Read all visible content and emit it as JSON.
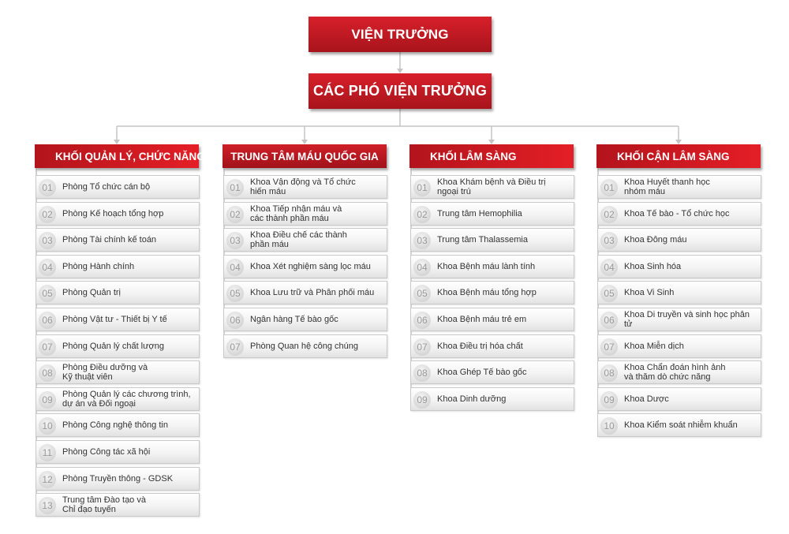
{
  "director": "VIỆN TRƯỞNG",
  "deputy": "CÁC PHÓ VIỆN TRƯỞNG",
  "columns": [
    {
      "title": "KHỐI QUẢN LÝ, CHỨC NĂNG",
      "items": [
        {
          "num": "01",
          "label": "Phòng Tổ chức cán bộ"
        },
        {
          "num": "02",
          "label": "Phòng Kế hoạch tổng hợp"
        },
        {
          "num": "03",
          "label": "Phòng Tài chính kế toán"
        },
        {
          "num": "04",
          "label": "Phòng Hành chính"
        },
        {
          "num": "05",
          "label": "Phòng Quản trị"
        },
        {
          "num": "06",
          "label": "Phòng Vật tư - Thiết bị Y tế"
        },
        {
          "num": "07",
          "label": "Phòng Quản lý chất lượng"
        },
        {
          "num": "08",
          "label": "Phòng Điều dưỡng và\nKỹ thuật viên"
        },
        {
          "num": "09",
          "label": "Phòng Quản lý các chương trình,\ndự án và Đối ngoại"
        },
        {
          "num": "10",
          "label": "Phòng Công nghệ thông tin"
        },
        {
          "num": "11",
          "label": "Phòng Công tác xã hội"
        },
        {
          "num": "12",
          "label": "Phòng Truyền thông - GDSK"
        },
        {
          "num": "13",
          "label": "Trung tâm Đào tạo và\nChỉ đạo tuyến"
        }
      ]
    },
    {
      "title": "TRUNG TÂM MÁU QUỐC GIA",
      "items": [
        {
          "num": "01",
          "label": "Khoa Vận động và Tổ chức\nhiến máu"
        },
        {
          "num": "02",
          "label": "Khoa Tiếp nhận máu và\ncác thành phần máu"
        },
        {
          "num": "03",
          "label": "Khoa Điều chế các thành\nphần máu"
        },
        {
          "num": "04",
          "label": "Khoa Xét nghiệm sàng lọc máu"
        },
        {
          "num": "05",
          "label": "Khoa Lưu trữ và Phân phối máu"
        },
        {
          "num": "06",
          "label": "Ngân hàng Tế bào gốc"
        },
        {
          "num": "07",
          "label": "Phòng Quan hệ công chúng"
        }
      ]
    },
    {
      "title": "KHỐI LÂM SÀNG",
      "items": [
        {
          "num": "01",
          "label": "Khoa Khám bệnh và Điều trị\nngoại trú"
        },
        {
          "num": "02",
          "label": "Trung tâm Hemophilia"
        },
        {
          "num": "03",
          "label": "Trung tâm Thalassemia"
        },
        {
          "num": "04",
          "label": "Khoa Bệnh máu lành tính"
        },
        {
          "num": "05",
          "label": "Khoa Bệnh máu tổng hợp"
        },
        {
          "num": "06",
          "label": "Khoa Bệnh máu trẻ em"
        },
        {
          "num": "07",
          "label": "Khoa Điều trị hóa chất"
        },
        {
          "num": "08",
          "label": "Khoa Ghép Tế bào gốc"
        },
        {
          "num": "09",
          "label": "Khoa Dinh dưỡng"
        }
      ]
    },
    {
      "title": "KHỐI CẬN LÂM SÀNG",
      "items": [
        {
          "num": "01",
          "label": "Khoa Huyết thanh học\nnhóm máu"
        },
        {
          "num": "02",
          "label": "Khoa Tế bào - Tổ chức học"
        },
        {
          "num": "03",
          "label": "Khoa Đông máu"
        },
        {
          "num": "04",
          "label": "Khoa Sinh hóa"
        },
        {
          "num": "05",
          "label": "Khoa Vi Sinh"
        },
        {
          "num": "06",
          "label": "Khoa Di truyền và sinh học phân tử"
        },
        {
          "num": "07",
          "label": "Khoa Miễn dịch"
        },
        {
          "num": "08",
          "label": "Khoa Chẩn đoán hình ảnh\nvà thăm dò chức năng"
        },
        {
          "num": "09",
          "label": "Khoa Dược"
        },
        {
          "num": "10",
          "label": "Khoa Kiểm soát nhiễm khuẩn"
        }
      ]
    }
  ]
}
